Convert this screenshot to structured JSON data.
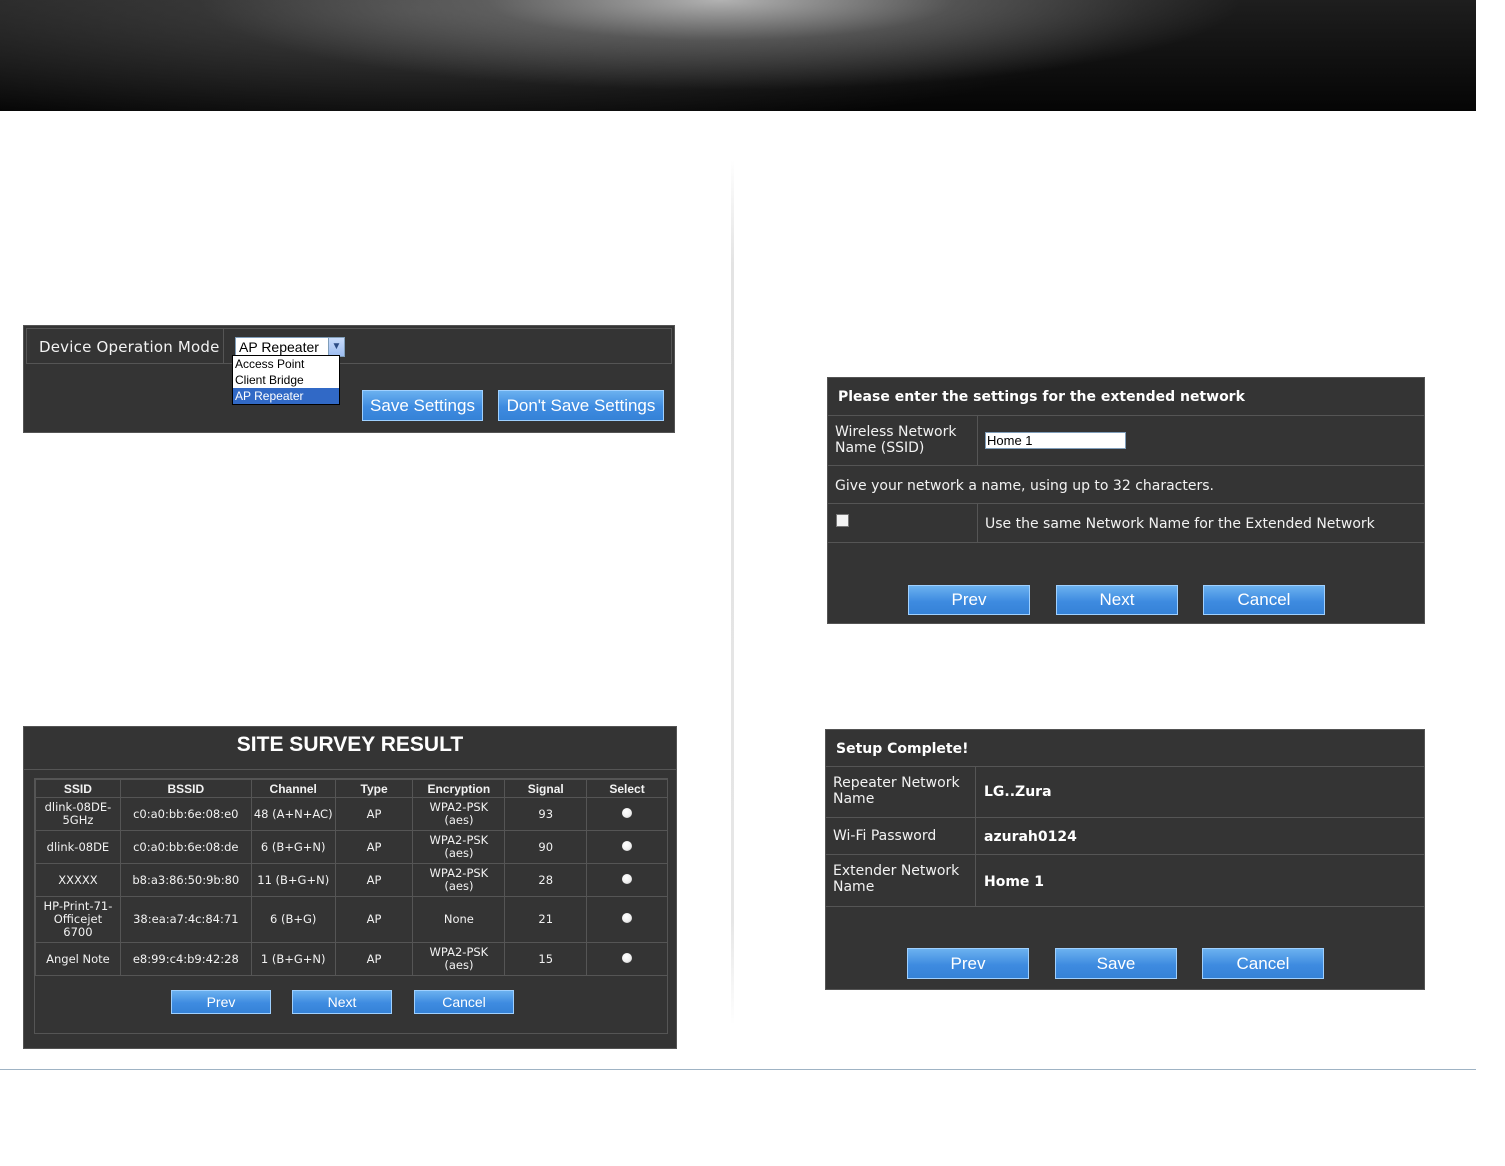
{
  "opmode": {
    "label": "Device Operation Mode",
    "selected": "AP Repeater",
    "options": [
      "Access Point",
      "Client Bridge",
      "AP Repeater"
    ],
    "save_label": "Save Settings",
    "dont_save_label": "Don't Save Settings"
  },
  "survey": {
    "title": "SITE SURVEY RESULT",
    "columns": [
      "SSID",
      "BSSID",
      "Channel",
      "Type",
      "Encryption",
      "Signal",
      "Select"
    ],
    "rows": [
      {
        "ssid": "dlink-08DE-5GHz",
        "bssid": "c0:a0:bb:6e:08:e0",
        "channel": "48 (A+N+AC)",
        "type": "AP",
        "encryption": "WPA2-PSK (aes)",
        "signal": "93"
      },
      {
        "ssid": "dlink-08DE",
        "bssid": "c0:a0:bb:6e:08:de",
        "channel": "6 (B+G+N)",
        "type": "AP",
        "encryption": "WPA2-PSK (aes)",
        "signal": "90"
      },
      {
        "ssid": "XXXXX",
        "bssid": "b8:a3:86:50:9b:80",
        "channel": "11 (B+G+N)",
        "type": "AP",
        "encryption": "WPA2-PSK (aes)",
        "signal": "28"
      },
      {
        "ssid": "HP-Print-71-Officejet 6700",
        "bssid": "38:ea:a7:4c:84:71",
        "channel": "6 (B+G)",
        "type": "AP",
        "encryption": "None",
        "signal": "21"
      },
      {
        "ssid": "Angel Note",
        "bssid": "e8:99:c4:b9:42:28",
        "channel": "1 (B+G+N)",
        "type": "AP",
        "encryption": "WPA2-PSK (aes)",
        "signal": "15"
      }
    ],
    "prev_label": "Prev",
    "next_label": "Next",
    "cancel_label": "Cancel"
  },
  "extended": {
    "heading": "Please enter the settings for the extended network",
    "ssid_label": "Wireless Network Name (SSID)",
    "ssid_value": "Home 1",
    "hint": "Give your network a name, using up to 32 characters.",
    "same_name_label": "Use the same Network Name for the Extended Network",
    "prev_label": "Prev",
    "next_label": "Next",
    "cancel_label": "Cancel"
  },
  "complete": {
    "heading": "Setup Complete!",
    "repeater_label": "Repeater Network Name",
    "repeater_value": "LG..Zura",
    "wifi_label": "Wi-Fi Password",
    "wifi_value": "azurah0124",
    "extender_label": "Extender Network Name",
    "extender_value": "Home 1",
    "prev_label": "Prev",
    "save_label": "Save",
    "cancel_label": "Cancel"
  }
}
